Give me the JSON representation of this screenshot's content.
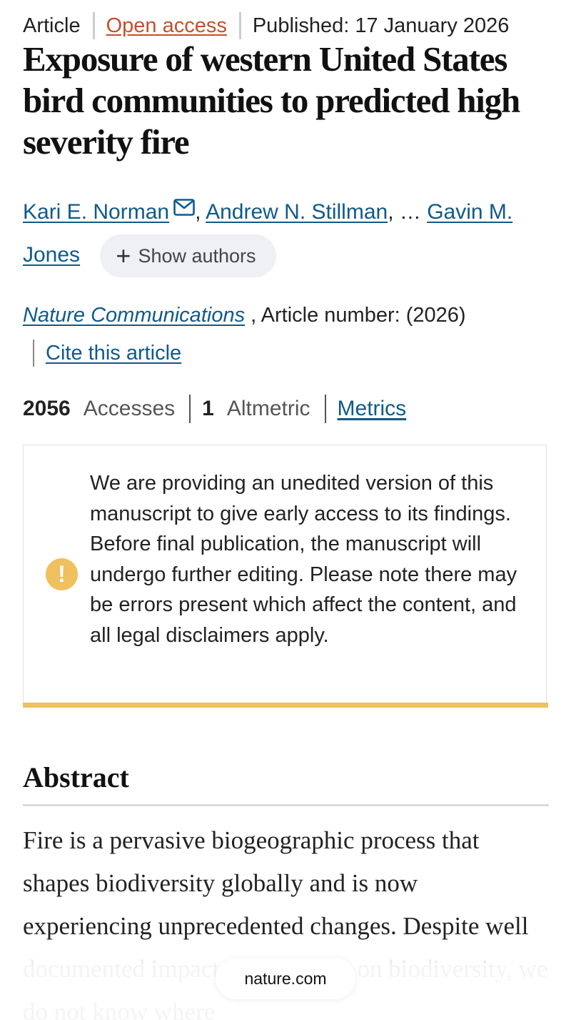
{
  "meta": {
    "type": "Article",
    "access": "Open access",
    "published": "Published: 17 January 2026"
  },
  "title": "Exposure of western United States bird communities to predicted high severity fire",
  "authors": {
    "first": "Kari E. Norman",
    "second": "Andrew N. Stillman",
    "ellipsis": ", …",
    "last": "Gavin M. Jones",
    "show_authors": "Show authors"
  },
  "journal": {
    "name": "Nature Communications",
    "rest": " , Article number:   (2026)",
    "cite": "Cite this article"
  },
  "metrics": {
    "accesses_count": "2056",
    "accesses_label": "Accesses",
    "altmetric_count": "1",
    "altmetric_label": "Altmetric",
    "metrics_link": "Metrics"
  },
  "notice": {
    "text": "We are providing an unedited version of this manuscript to give early access to its findings. Before final publication, the manuscript will undergo further editing. Please note there may be errors present which affect the content, and all legal disclaimers apply.",
    "icon": "exclamation-icon",
    "accent_color": "#f0c05e"
  },
  "abstract": {
    "heading": "Abstract",
    "text": "Fire is a pervasive biogeographic process that shapes biodiversity globally and is now experiencing unprecedented changes. Despite well documented impacts of wildfires on biodiversity, we do not know where"
  },
  "browser": {
    "url": "nature.com"
  },
  "colors": {
    "link": "#0f5a8a",
    "open_access": "#c0512b"
  }
}
